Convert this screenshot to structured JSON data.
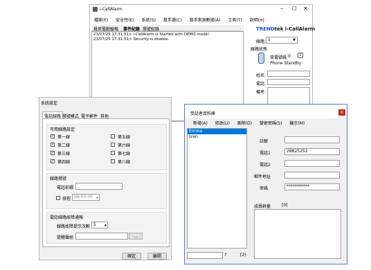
{
  "main_window": {
    "title": "i-CallAlarm",
    "menu": [
      "檔案(F)",
      "安全性(E)",
      "系統(S)",
      "幫手選(C)",
      "幫手來源數據(A)",
      "工具(T)",
      "說明(H)"
    ],
    "tabs": [
      "員來電勤驗報",
      "事件紀錄",
      "撥號紀錄"
    ],
    "log_lines": [
      "23/07/25 17:31:51> i-CallAlarm is Started with DEMO mode!",
      "23/07/25 17:31:51> Security is disable."
    ],
    "brand_red": "TREND",
    "brand_black": "tek i-CallAlarm",
    "line_label": "線路:",
    "line_value": "1",
    "line_status_label": "線路狀態",
    "caller_id_label": "來電號碼",
    "caller_id_value": "0",
    "phone_status": "Phone Standby",
    "name_label": "姓名:",
    "phone_label": "電話:",
    "note_label": "備考:"
  },
  "settings_window": {
    "title": "系統設定",
    "tabs": [
      "電話線路",
      "撥號模式",
      "電子郵件",
      "其他"
    ],
    "lines_group_title": "可用線路設定",
    "lines": [
      {
        "label": "第一線",
        "checked": true
      },
      {
        "label": "第二線",
        "checked": true
      },
      {
        "label": "第三線",
        "checked": true
      },
      {
        "label": "第四線",
        "checked": true
      },
      {
        "label": "第五線",
        "checked": false
      },
      {
        "label": "第六線",
        "checked": false
      },
      {
        "label": "第七線",
        "checked": false
      },
      {
        "label": "第八線",
        "checked": false
      }
    ],
    "dial_group_title": "線路撥號",
    "dial_prefix_label": "電話前綴",
    "dial_time_label": "排程",
    "dial_time_value": "08:00:00",
    "redial_group_title": "電話線路故障通報",
    "retry_label": "線路故障提示次數",
    "retry_value": "5",
    "sound_label": "提醒聲經",
    "browse_label": "...",
    "ok_label": "確定",
    "cancel_label": "離開"
  },
  "contacts_window": {
    "title": "受話者資料庫",
    "menu": [
      "新增(A)",
      "修改(U)",
      "刪除(D)",
      "變更密碼(S)",
      "顯示(M)"
    ],
    "list": [
      "Emma",
      "Ivan"
    ],
    "search_icon_label": "f",
    "count_label": "[2]",
    "fields": [
      {
        "label": "註解",
        "value": ""
      },
      {
        "label": "電話1",
        "value": "28825252"
      },
      {
        "label": "電話2",
        "value": ""
      },
      {
        "label": "郵件地址",
        "value": ""
      },
      {
        "label": "密碼",
        "value": "***********"
      }
    ],
    "members_label": "成員群量",
    "members_count": "[0]"
  }
}
